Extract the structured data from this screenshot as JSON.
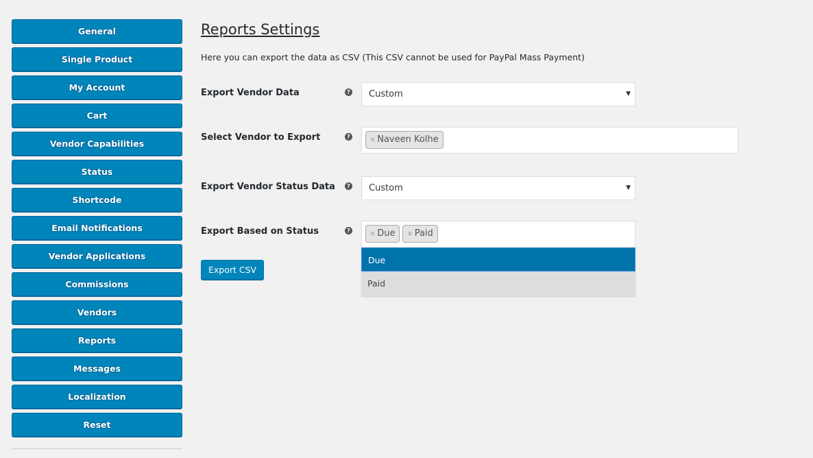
{
  "sidebar": {
    "items": [
      {
        "label": "General"
      },
      {
        "label": "Single Product"
      },
      {
        "label": "My Account"
      },
      {
        "label": "Cart"
      },
      {
        "label": "Vendor Capabilities"
      },
      {
        "label": "Status"
      },
      {
        "label": "Shortcode"
      },
      {
        "label": "Email Notifications"
      },
      {
        "label": "Vendor Applications"
      },
      {
        "label": "Commissions"
      },
      {
        "label": "Vendors"
      },
      {
        "label": "Reports"
      },
      {
        "label": "Messages"
      },
      {
        "label": "Localization"
      },
      {
        "label": "Reset"
      }
    ]
  },
  "main": {
    "title": "Reports Settings",
    "description": "Here you can export the data as CSV (This CSV cannot be used for PayPal Mass Payment)",
    "help_glyph": "?",
    "fields": {
      "export_vendor_data": {
        "label": "Export Vendor Data",
        "value": "Custom",
        "arrow": "▼"
      },
      "select_vendor": {
        "label": "Select Vendor to Export",
        "tags": [
          "Naveen Kolhe"
        ]
      },
      "export_vendor_status": {
        "label": "Export Vendor Status Data",
        "value": "Custom",
        "arrow": "▼"
      },
      "export_based_on_status": {
        "label": "Export Based on Status",
        "tags": [
          "Due",
          "Paid"
        ]
      }
    },
    "remove_glyph": "×",
    "dropdown_options": [
      {
        "label": "Due",
        "highlighted": true
      },
      {
        "label": "Paid",
        "highlighted": false
      }
    ],
    "export_button": "Export CSV"
  },
  "colors": {
    "primary": "#0085ba",
    "highlight": "#0073aa",
    "background": "#f1f1f1"
  }
}
